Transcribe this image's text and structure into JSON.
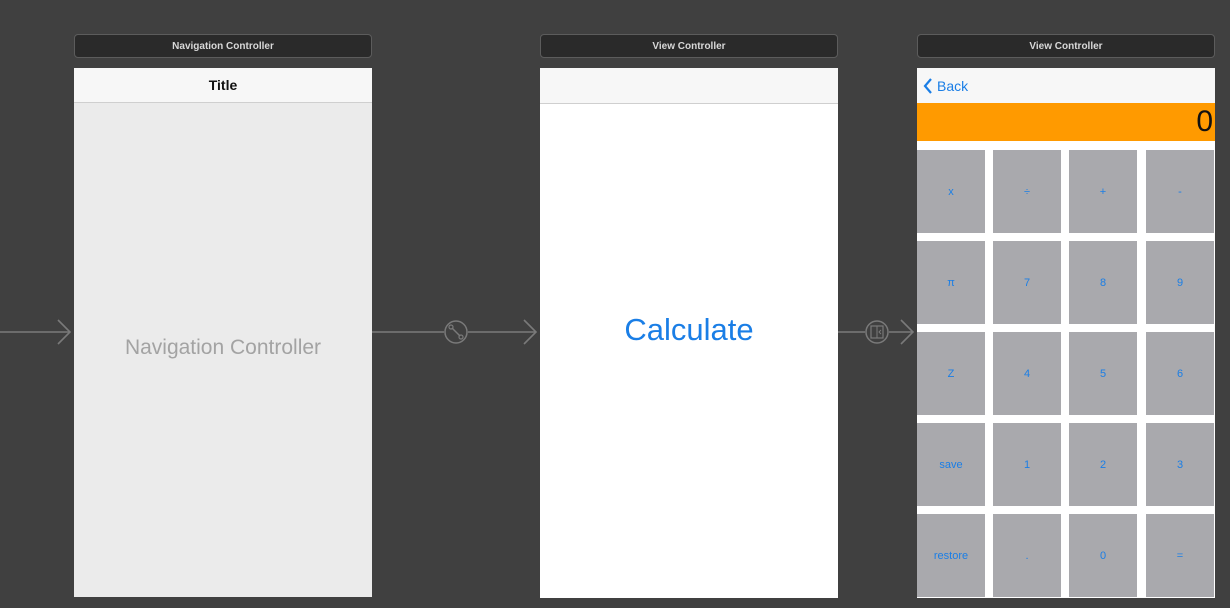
{
  "scenes": {
    "navigation": {
      "header": "Navigation Controller",
      "nav_title": "Title",
      "placeholder": "Navigation Controller"
    },
    "view1": {
      "header": "View Controller",
      "calculate_label": "Calculate"
    },
    "view2": {
      "header": "View Controller",
      "back_label": "Back",
      "display_value": "0",
      "keys": [
        "x",
        "÷",
        "+",
        "-",
        "π",
        "7",
        "8",
        "9",
        "Z",
        "4",
        "5",
        "6",
        "save",
        "1",
        "2",
        "3",
        "restore",
        ".",
        "0",
        "="
      ]
    }
  },
  "colors": {
    "canvas": "#404040",
    "tint": "#1a7ee6",
    "display": "#ff9a00",
    "key": "#a9a9ad"
  },
  "icons": {
    "segue_relationship": "link-icon",
    "segue_show": "show-segue-icon",
    "back": "chevron-left-icon"
  }
}
